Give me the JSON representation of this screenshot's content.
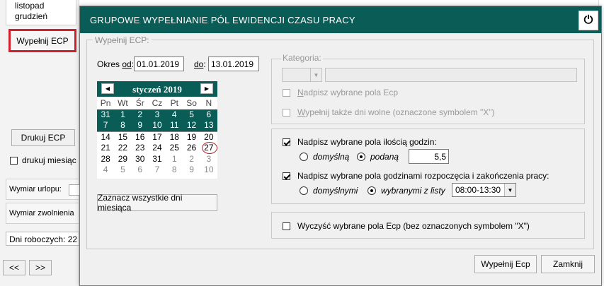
{
  "background": {
    "months": [
      "listopad",
      "grudzień"
    ],
    "fill_button": "Wypełnij ECP",
    "print_button": "Drukuj ECP",
    "print_month_check": "drukuj miesiąc",
    "leave_field": "Wymiar urlopu:",
    "release_field": "Wymiar zwolnienia",
    "working_days": "Dni roboczych: 22",
    "nav_prev": "<<",
    "nav_next": ">>"
  },
  "dialog": {
    "title": "GRUPOWE WYPEŁNIANIE PÓL EWIDENCJI CZASU PRACY",
    "power_icon": "power-icon",
    "main_legend": "Wypełnij ECP:",
    "period_label_prefix": "Okres ",
    "period_label_key": "od",
    "period_label_suffix": ":",
    "from_value": "01.01.2019",
    "to_label_key": "do",
    "to_label_suffix": ":",
    "to_value": "13.01.2019",
    "calendar": {
      "month_label": "styczeń 2019",
      "prev_icon": "◀",
      "next_icon": "▶",
      "weekdays": [
        "Pn",
        "Wt",
        "Śr",
        "Cz",
        "Pt",
        "So",
        "N"
      ],
      "weeks": [
        [
          "31",
          "1",
          "2",
          "3",
          "4",
          "5",
          "6"
        ],
        [
          "7",
          "8",
          "9",
          "10",
          "11",
          "12",
          "13"
        ],
        [
          "14",
          "15",
          "16",
          "17",
          "18",
          "19",
          "20"
        ],
        [
          "21",
          "22",
          "23",
          "24",
          "25",
          "26",
          "27"
        ],
        [
          "28",
          "29",
          "30",
          "31",
          "1",
          "2",
          "3"
        ],
        [
          "4",
          "5",
          "6",
          "7",
          "8",
          "9",
          "10"
        ]
      ],
      "selected_weeks": [
        0,
        1
      ],
      "today": "27"
    },
    "select_all_button": "Zaznacz wszystkie dni miesiąca",
    "category": {
      "legend": "Kategoria:",
      "overwrite_prefix": "",
      "overwrite_key": "N",
      "overwrite_rest": "adpisz wybrane pola Ecp",
      "free_days_prefix": "",
      "free_days_key": "W",
      "free_days_rest": "ypełnij także dni wolne (oznaczone symbolem \"X\")"
    },
    "hours": {
      "overwrite_hours_label": "Nadpisz wybrane pola ilością godzin:",
      "overwrite_hours_checked": true,
      "default_label": "domyślną",
      "given_label": "podaną",
      "selected": "podaną",
      "hours_value": "5,5",
      "overwrite_times_label": "Nadpisz wybrane pola godzinami rozpoczęcia i zakończenia pracy:",
      "overwrite_times_checked": true,
      "default_times_label": "domyślnymi",
      "list_times_label": "wybranymi z listy",
      "times_selected": "wybranymi z listy",
      "times_value": "08:00-13:30"
    },
    "clear_label": "Wyczyść wybrane pola Ecp (bez oznaczonych symbolem \"X\")",
    "clear_checked": false,
    "fill_button": "Wypełnij Ecp",
    "close_button": "Zamknij"
  }
}
